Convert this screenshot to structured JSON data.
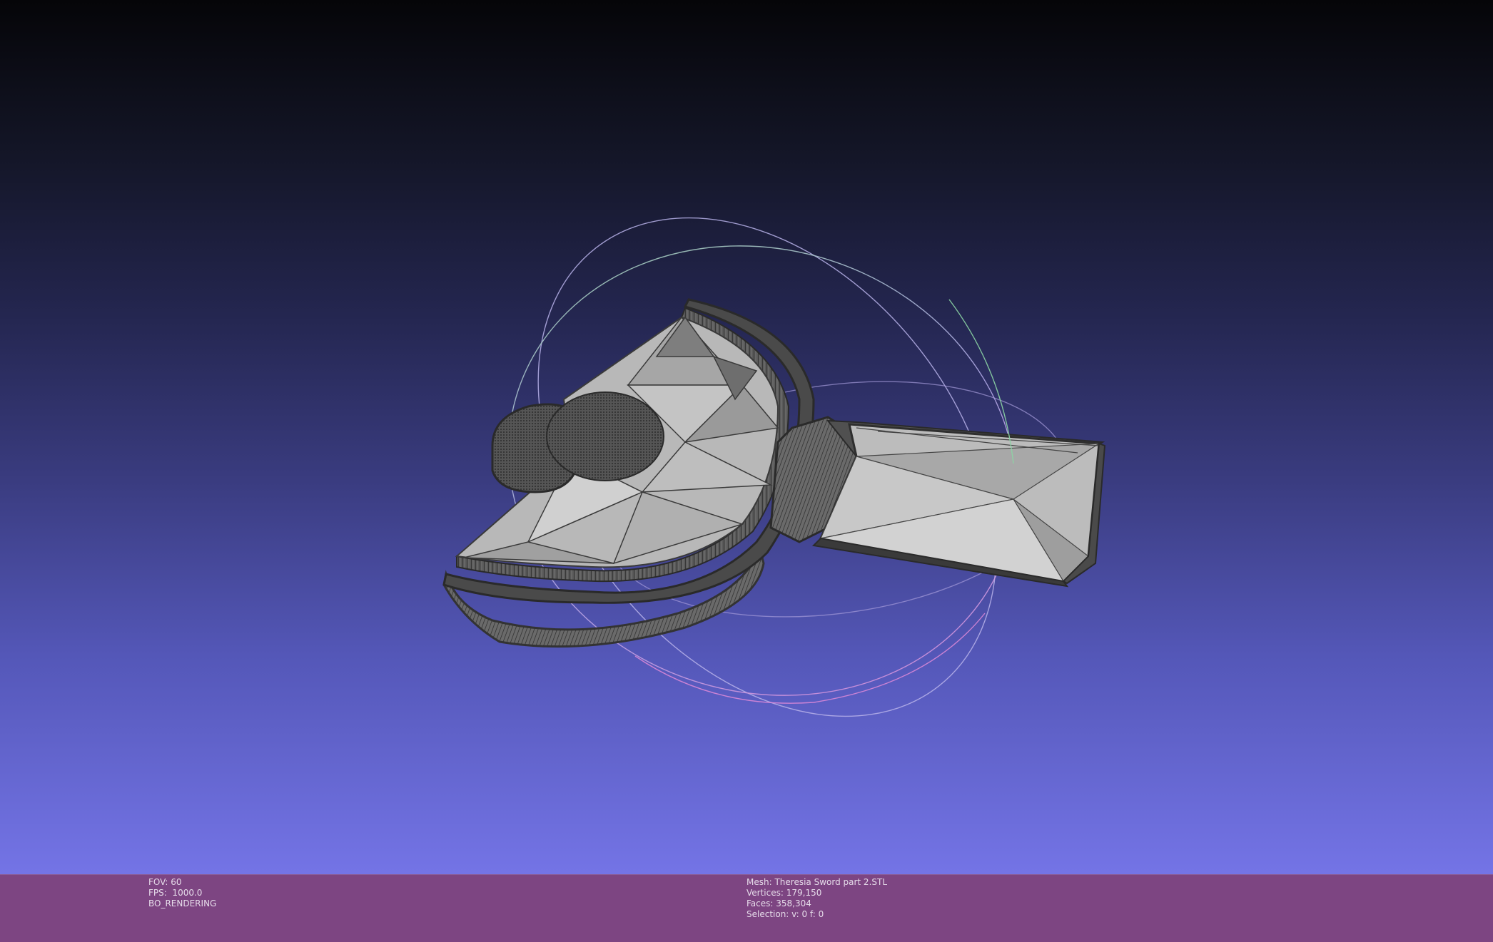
{
  "viewer": {
    "background_top": "#050508",
    "background_bottom": "#7474e6",
    "trackball_colors": {
      "x_ring": "#d77ad0",
      "y_ring": "#8cd4a4",
      "z_ring": "#a09ae0"
    },
    "mesh_colors": {
      "face": "#b4b4b4",
      "wire": "#444444"
    }
  },
  "status": {
    "left": {
      "fov": "FOV: 60",
      "fps": "FPS:  1000.0",
      "mode": "BO_RENDERING"
    },
    "center": {
      "mesh": "Mesh: Theresia Sword part 2.STL",
      "vertices": "Vertices: 179,150",
      "faces": "Faces: 358,304",
      "selection": "Selection: v: 0 f: 0"
    },
    "bar_color": "#7d4582"
  }
}
